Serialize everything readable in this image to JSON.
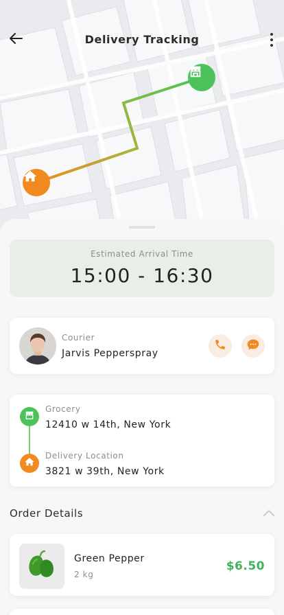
{
  "header": {
    "title": "Delivery Tracking"
  },
  "map": {
    "route_color_start": "#4cc35a",
    "route_color_end": "#f08a1f",
    "store_marker_icon": "store-icon",
    "home_marker_icon": "home-icon"
  },
  "eta": {
    "label": "Estimated Arrival Time",
    "time": "15:00 - 16:30"
  },
  "courier": {
    "role": "Courier",
    "name": "Jarvis Pepperspray",
    "call_icon": "phone-icon",
    "chat_icon": "chat-icon"
  },
  "route": {
    "origin_label": "Grocery",
    "origin_address": "12410 w 14th, New York",
    "destination_label": "Delivery Location",
    "destination_address": "3821 w 39th, New York"
  },
  "order": {
    "title": "Order Details",
    "items": [
      {
        "name": "Green Pepper",
        "quantity": "2 kg",
        "price": "$6.50"
      }
    ]
  },
  "colors": {
    "accent_green": "#4cc35a",
    "accent_orange": "#f08a1f",
    "price_green": "#3fb55a",
    "eta_bg": "#e9efe8"
  }
}
